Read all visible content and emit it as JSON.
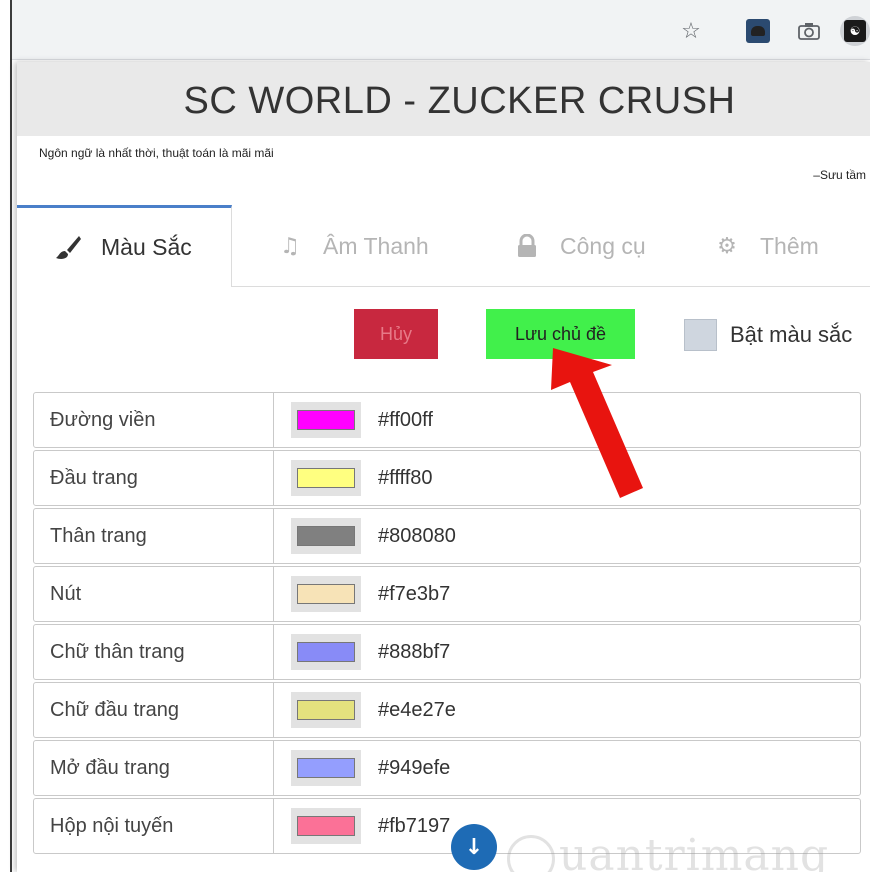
{
  "browser": {
    "star_icon": "star-icon",
    "camera_icon": "camera-icon"
  },
  "header": {
    "title": "SC WORLD - ZUCKER CRUSH",
    "slogan": "Ngôn ngữ là nhất thời, thuật toán là mãi mãi",
    "credit": "–Sưu tầm"
  },
  "tabs": [
    {
      "label": "Màu Sắc",
      "icon": "brush-icon",
      "active": true
    },
    {
      "label": "Âm Thanh",
      "icon": "music-icon",
      "active": false
    },
    {
      "label": "Công cụ",
      "icon": "lock-icon",
      "active": false
    },
    {
      "label": "Thêm",
      "icon": "gear-icon",
      "active": false
    }
  ],
  "actions": {
    "cancel_label": "Hủy",
    "save_label": "Lưu chủ đề",
    "toggle_label": "Bật màu sắc"
  },
  "colors": [
    {
      "label": "Đường viền",
      "hex": "#ff00ff"
    },
    {
      "label": "Đầu trang",
      "hex": "#ffff80"
    },
    {
      "label": "Thân trang",
      "hex": "#808080"
    },
    {
      "label": "Nút",
      "hex": "#f7e3b7"
    },
    {
      "label": "Chữ thân trang",
      "hex": "#888bf7"
    },
    {
      "label": "Chữ đầu trang",
      "hex": "#e4e27e"
    },
    {
      "label": "Mở đầu trang",
      "hex": "#949efe"
    },
    {
      "label": "Hộp nội tuyến",
      "hex": "#fb7197"
    }
  ],
  "watermark": "uantrimang",
  "theme": {
    "accent": "#4a7fc9",
    "cancel_bg": "#c8283f",
    "save_bg": "#41f04b",
    "arrow": "#e8140f",
    "scroll_btn": "#1e6bb5"
  }
}
